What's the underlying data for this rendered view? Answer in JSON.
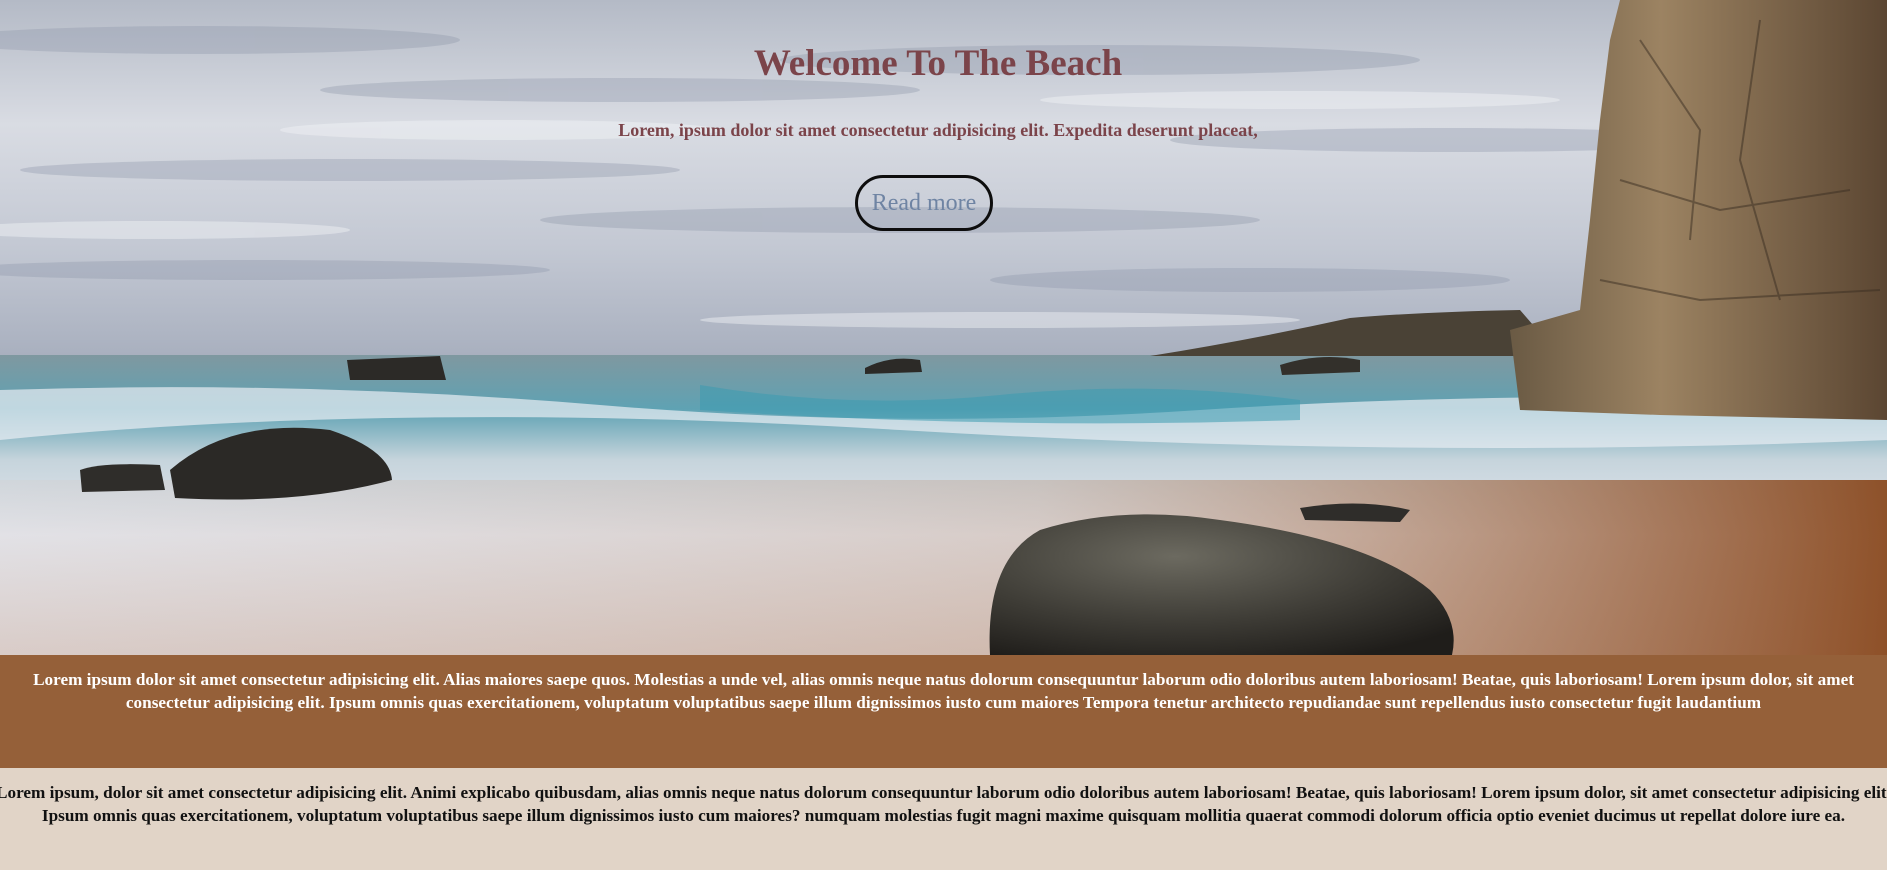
{
  "hero": {
    "title": "Welcome To The Beach",
    "subtitle": "Lorem, ipsum dolor sit amet consectetur adipisicing elit. Expedita deserunt placeat,",
    "button_label": "Read more",
    "image_alt": "beach-photo"
  },
  "colors": {
    "title": "#7b444a",
    "button_text": "#6f84a3",
    "brown_band": "#956039",
    "beige_band": "#e1d4c7"
  },
  "section_brown": {
    "text": "Lorem ipsum dolor sit amet consectetur adipisicing elit. Alias maiores saepe quos. Molestias a unde vel, alias omnis neque natus dolorum consequuntur laborum odio doloribus autem laboriosam! Beatae, quis laboriosam! Lorem ipsum dolor, sit amet consectetur adipisicing elit. Ipsum omnis quas exercitationem, voluptatum voluptatibus saepe illum dignissimos iusto cum maiores Tempora tenetur architecto repudiandae sunt repellendus iusto consectetur fugit laudantium"
  },
  "section_beige": {
    "text": "Lorem ipsum, dolor sit amet consectetur adipisicing elit. Animi explicabo quibusdam, alias omnis neque natus dolorum consequuntur laborum odio doloribus autem laboriosam! Beatae, quis laboriosam! Lorem ipsum dolor, sit amet consectetur adipisicing elit. Ipsum omnis quas exercitationem, voluptatum voluptatibus saepe illum dignissimos iusto cum maiores? numquam molestias fugit magni maxime quisquam mollitia quaerat commodi dolorum officia optio eveniet ducimus ut repellat dolore iure ea."
  }
}
